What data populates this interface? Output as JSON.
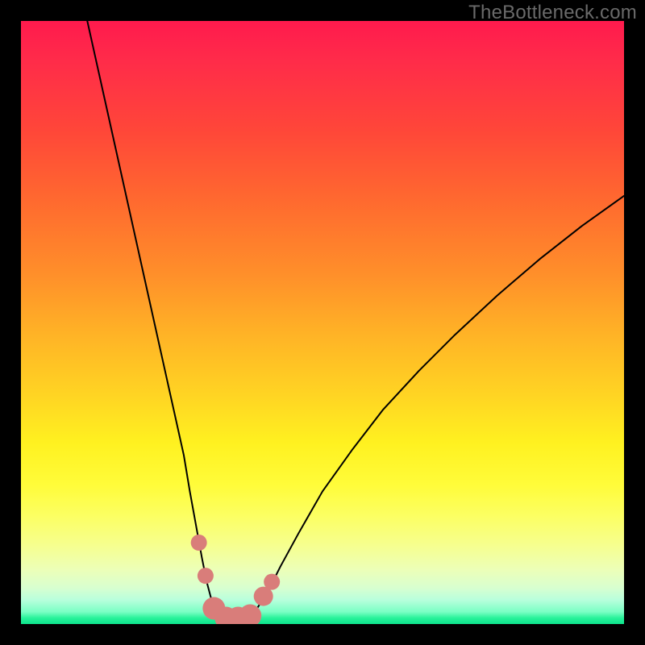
{
  "branding": {
    "watermark": "TheBottleneck.com"
  },
  "colors": {
    "frame": "#000000",
    "curve": "#000000",
    "marker_fill": "#d97d7a",
    "marker_stroke": "#d97d7a"
  },
  "chart_data": {
    "type": "line",
    "title": "",
    "xlabel": "",
    "ylabel": "",
    "xlim": [
      0,
      100
    ],
    "ylim": [
      0,
      100
    ],
    "grid": false,
    "series": [
      {
        "name": "left-curve",
        "x": [
          11,
          13,
          15,
          17,
          19,
          21,
          23,
          25,
          27,
          28,
          29,
          30,
          30.8,
          31.6,
          32.4,
          33
        ],
        "y": [
          100,
          91,
          82,
          73,
          64,
          55,
          46,
          37,
          28,
          22,
          16.5,
          11,
          7,
          4,
          2,
          1
        ]
      },
      {
        "name": "bottom-flat",
        "x": [
          33,
          34,
          35,
          36,
          37,
          38
        ],
        "y": [
          1,
          0.8,
          0.8,
          0.8,
          0.8,
          1
        ]
      },
      {
        "name": "right-curve",
        "x": [
          38,
          39,
          40,
          41.5,
          43,
          46,
          50,
          55,
          60,
          66,
          72,
          79,
          86,
          93,
          100
        ],
        "y": [
          1,
          2.3,
          4,
          6.5,
          9.5,
          15,
          22,
          29,
          35.5,
          42,
          48,
          54.5,
          60.5,
          66,
          71
        ]
      }
    ],
    "markers": [
      {
        "x": 29.5,
        "y": 13.5,
        "r": 10
      },
      {
        "x": 30.6,
        "y": 8.0,
        "r": 10
      },
      {
        "x": 32.0,
        "y": 2.6,
        "r": 14
      },
      {
        "x": 34.0,
        "y": 1.0,
        "r": 14
      },
      {
        "x": 36.0,
        "y": 1.0,
        "r": 14
      },
      {
        "x": 38.0,
        "y": 1.4,
        "r": 14
      },
      {
        "x": 40.2,
        "y": 4.6,
        "r": 12
      },
      {
        "x": 41.6,
        "y": 7.0,
        "r": 10
      }
    ],
    "annotations": []
  }
}
